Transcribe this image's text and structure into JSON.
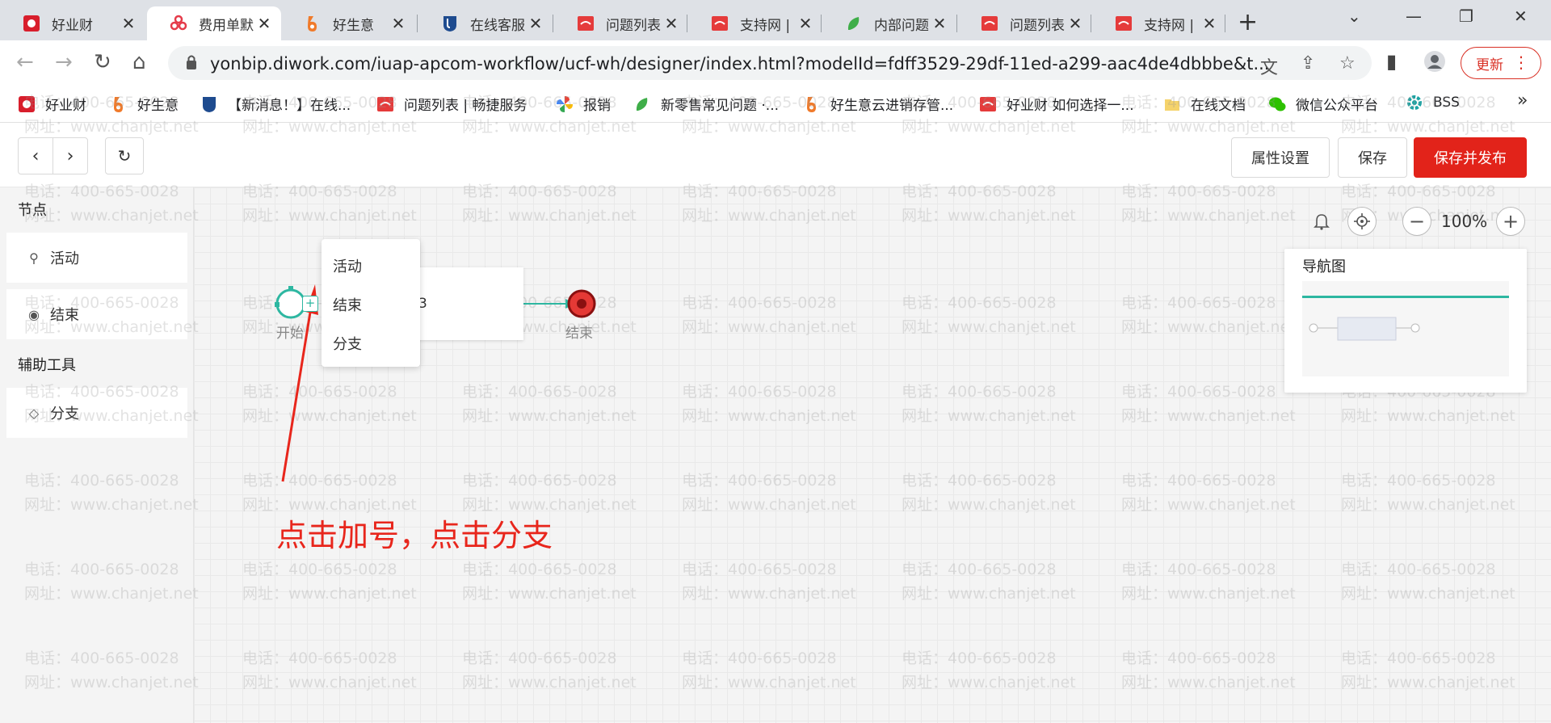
{
  "browser": {
    "tabs": [
      {
        "title": "好业财",
        "favicon": "red-badge-icon"
      },
      {
        "title": "费用单默",
        "favicon": "pink-flower-icon",
        "active": true
      },
      {
        "title": "好生意",
        "favicon": "orange-6-icon"
      },
      {
        "title": "在线客服",
        "favicon": "blue-shield-icon"
      },
      {
        "title": "问题列表",
        "favicon": "chanjet-red-icon"
      },
      {
        "title": "支持网 |",
        "favicon": "chanjet-red-icon"
      },
      {
        "title": "内部问题",
        "favicon": "green-leaf-icon"
      },
      {
        "title": "问题列表",
        "favicon": "chanjet-red-icon"
      },
      {
        "title": "支持网 |",
        "favicon": "chanjet-red-icon"
      }
    ],
    "url": "yonbip.diwork.com/iuap-apcom-workflow/ucf-wh/designer/index.html?modelId=fdff3529-29df-11ed-a299-aac4de4dbbbe&t...",
    "update_label": "更新",
    "bookmarks": [
      {
        "label": "好业财",
        "icon": "red-badge-icon"
      },
      {
        "label": "好生意",
        "icon": "orange-6-icon"
      },
      {
        "label": "【新消息！】在线...",
        "icon": "blue-shield-icon"
      },
      {
        "label": "问题列表 | 畅捷服务",
        "icon": "chanjet-red-icon"
      },
      {
        "label": "报销",
        "icon": "pinwheel-icon"
      },
      {
        "label": "新零售常见问题 ·...",
        "icon": "green-leaf-icon"
      },
      {
        "label": "好生意云进销存管...",
        "icon": "orange-6-icon"
      },
      {
        "label": "好业财 如何选择一...",
        "icon": "chanjet-red-icon"
      },
      {
        "label": "在线文档",
        "icon": "folder-icon"
      },
      {
        "label": "微信公众平台",
        "icon": "wechat-icon"
      },
      {
        "label": "BSS",
        "icon": "gear-icon"
      }
    ]
  },
  "toolbar": {
    "props_label": "属性设置",
    "save_label": "保存",
    "save_publish_label": "保存并发布"
  },
  "left_panel": {
    "nodes_title": "节点",
    "node_items": [
      {
        "label": "活动",
        "icon": "person-icon"
      },
      {
        "label": "结束",
        "icon": "radio-dot-icon"
      }
    ],
    "tools_title": "辅助工具",
    "tool_items": [
      {
        "label": "分支",
        "icon": "diamond-icon"
      }
    ]
  },
  "canvas": {
    "start_label": "开始",
    "end_label": "结束",
    "activity_text": "3",
    "zoom": "100%",
    "navmap_title": "导航图",
    "context_menu": [
      "活动",
      "结束",
      "分支"
    ],
    "annotation": "点击加号，点击分支",
    "watermark_phone": "电话：400-665-0028",
    "watermark_site": "网址：www.chanjet.net",
    "colors": {
      "accent": "#2db7a1",
      "primary": "#e2231a",
      "annotation": "#e8261c"
    }
  }
}
